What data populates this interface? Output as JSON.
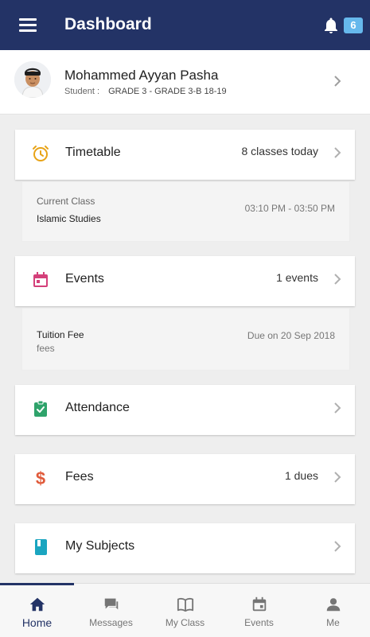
{
  "header": {
    "title": "Dashboard",
    "notification_count": "6",
    "colors": {
      "bar": "#233366",
      "badge": "#66b8ec"
    }
  },
  "profile": {
    "name": "Mohammed Ayyan Pasha",
    "role_label": "Student :",
    "grade": "GRADE 3 - GRADE 3-B 18-19"
  },
  "timetable": {
    "title": "Timetable",
    "summary": "8 classes today",
    "current_label": "Current Class",
    "current_subject": "Islamic Studies",
    "time": "03:10 PM - 03:50 PM",
    "icon": "alarm-clock-icon",
    "color": "#e8a317"
  },
  "events": {
    "title": "Events",
    "summary": "1 events",
    "item_title": "Tuition Fee",
    "item_sub": "fees",
    "due": "Due on 20 Sep 2018",
    "icon": "calendar-icon",
    "color": "#d4407a"
  },
  "attendance": {
    "title": "Attendance",
    "icon": "clipboard-check-icon",
    "color": "#2fa36b"
  },
  "fees": {
    "title": "Fees",
    "summary": "1 dues",
    "icon": "dollar-icon",
    "color": "#e05a3a"
  },
  "subjects": {
    "title": "My Subjects",
    "icon": "book-icon",
    "color": "#1aa5c0"
  },
  "nav": {
    "home": "Home",
    "messages": "Messages",
    "myclass": "My Class",
    "events": "Events",
    "me": "Me"
  }
}
